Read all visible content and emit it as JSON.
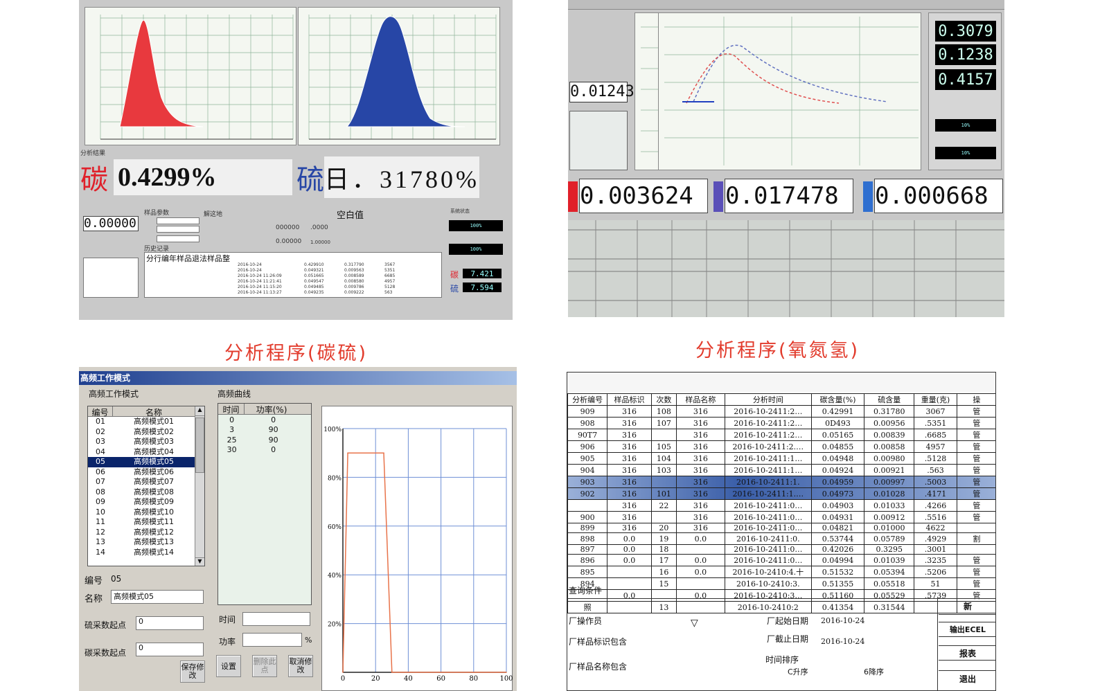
{
  "q1": {
    "title_fragment": "分析程序 碳硫",
    "result_label": "分析结果",
    "carbon_label": "碳",
    "carbon_value": "0.4299%",
    "sulfur_label": "硫",
    "sulfur_value": "日．31780%",
    "lcd_main": "0.00000",
    "sample_params_label": "样品参数",
    "solution_label": "解这地",
    "blank_label": "空白值",
    "system_status_label": "系统状态",
    "history_label": "历史记录",
    "history_header": "分行编年样品退法样品整",
    "sulfur_lcd": "7.594",
    "carbon_lcd": "7.421",
    "status_lcd1": "100%",
    "status_lcd2": "100%",
    "legend_c": "碳",
    "legend_s": "硫",
    "mid_values": [
      "000000",
      ".0000",
      "0.00000",
      "1.00000"
    ],
    "history_rows": [
      [
        "2016-10-24",
        "0.429910",
        "0.317790",
        "3567"
      ],
      [
        "2016-10-24",
        "0.049321",
        "0.009563",
        "5351"
      ],
      [
        "2016-10-24 11:26:09",
        "0.051665",
        "0.008589",
        "6685"
      ],
      [
        "2016-10-24 11:21:41",
        "0.049547",
        "0.008580",
        "4957"
      ],
      [
        "2016-10-24 11:15:20",
        "0.049485",
        "0.009786",
        "5128"
      ],
      [
        "2016-10-24 11:13:27",
        "0.049235",
        "0.009222",
        "563"
      ]
    ]
  },
  "q2": {
    "lcd_left": "0.01243",
    "right_lcds": [
      "0.3079",
      "0.1238",
      "0.4157"
    ],
    "right_small": [
      "10%",
      "10%"
    ],
    "bottom_lcds": [
      "0.003624",
      "0.017478",
      "0.000668"
    ],
    "bottom_colors": [
      "#e0202a",
      "#5a4fb8",
      "#2f6fd0"
    ]
  },
  "captions": {
    "left": "分析程序(碳硫)",
    "right": "分析程序(氧氮氢)"
  },
  "q3": {
    "window_title": "高频工作模式",
    "group_left": "高频工作模式",
    "group_curve": "高频曲线",
    "col_no": "编号",
    "col_name": "名称",
    "modes": [
      {
        "no": "01",
        "name": "高频模式01"
      },
      {
        "no": "02",
        "name": "高频模式02"
      },
      {
        "no": "03",
        "name": "高频模式03"
      },
      {
        "no": "04",
        "name": "高频模式04"
      },
      {
        "no": "05",
        "name": "高频模式05"
      },
      {
        "no": "06",
        "name": "高频模式06"
      },
      {
        "no": "07",
        "name": "高频模式07"
      },
      {
        "no": "08",
        "name": "高频模式08"
      },
      {
        "no": "09",
        "name": "高频模式09"
      },
      {
        "no": "10",
        "name": "高频模式10"
      },
      {
        "no": "11",
        "name": "高频模式11"
      },
      {
        "no": "12",
        "name": "高频模式12"
      },
      {
        "no": "13",
        "name": "高频模式13"
      },
      {
        "no": "14",
        "name": "高频模式14"
      }
    ],
    "selected_index": 4,
    "col_time": "时间",
    "col_power": "功率(%)",
    "curve_rows": [
      {
        "time": "0",
        "power": "0"
      },
      {
        "time": "3",
        "power": "90"
      },
      {
        "time": "25",
        "power": "90"
      },
      {
        "time": "30",
        "power": "0"
      }
    ],
    "no_label": "编号",
    "no_value": "05",
    "name_label": "名称",
    "name_value": "高频模式05",
    "s_start_label": "硫采数起点",
    "s_start_value": "0",
    "c_start_label": "碳采数起点",
    "c_start_value": "0",
    "save_btn": "保存修改",
    "time_label": "时间",
    "power_label": "功率",
    "percent": "%",
    "set_btn": "设置",
    "delete_btn": "删除此点",
    "cancel_btn": "取消修改",
    "y_ticks": [
      "100%",
      "80%",
      "60%",
      "40%",
      "20%"
    ],
    "x_ticks": [
      "0",
      "20",
      "40",
      "60",
      "80",
      "100"
    ]
  },
  "chart_data": {
    "type": "line",
    "x": [
      0,
      3,
      25,
      30,
      100
    ],
    "series": [
      {
        "values": [
          0,
          90,
          90,
          0,
          0
        ]
      }
    ],
    "xlim": [
      0,
      100
    ],
    "ylim": [
      0,
      100
    ],
    "grid": true
  },
  "q4": {
    "headers": [
      "分析编号",
      "样品标识",
      "次数",
      "样品名称",
      "分析时间",
      "碳含量(%)",
      "硫含量",
      "重量(克)",
      "操"
    ],
    "rows": [
      [
        "909",
        "316",
        "108",
        "316",
        "2016-10-2411:2…",
        "0.42991",
        "0.31780",
        "3067",
        "管"
      ],
      [
        "908",
        "316",
        "107",
        "316",
        "2016-10-2411:2…",
        "0D493",
        "0.00956",
        ".5351",
        "管"
      ],
      [
        "90T7",
        "316",
        "",
        "316",
        "2016-10-2411:2…",
        "0.05165",
        "0.00839",
        ".6685",
        "管"
      ],
      [
        "906",
        "316",
        "105",
        "316",
        "2016-10-2411:2.…",
        "0.04855",
        "0.00858",
        "4957",
        "管"
      ],
      [
        "905",
        "316",
        "104",
        "316",
        "2016-10-2411:1…",
        "0.04948",
        "0.00980",
        ".5128",
        "管"
      ],
      [
        "904",
        "316",
        "103",
        "316",
        "2016-10-2411:1…",
        "0.04924",
        "0.00921",
        ".563",
        "管"
      ],
      [
        "903",
        "316",
        "",
        "316",
        "2016-10-2411:1.",
        "0.04959",
        "0.00997",
        ".5003",
        "管"
      ],
      [
        "902",
        "316",
        "101",
        "316",
        "2016-10-2411:1.…",
        "0.04973",
        "0.01028",
        ".4171",
        "管"
      ],
      [
        "",
        "316",
        "22",
        "316",
        "2016-10-2411:0…",
        "0.04903",
        "0.01033",
        ".4266",
        "管"
      ],
      [
        "900",
        "316",
        "",
        "316",
        "2016-10-2411:0…",
        "0.04931",
        "0.00912",
        ".5516",
        "管"
      ],
      [
        "899",
        "316",
        "20",
        "316",
        "2016-10-2411:0…",
        "0.04821",
        "0.01000",
        "4622",
        ""
      ],
      [
        "898",
        "0.0",
        "19",
        "0.0",
        "2016-10-2411:0.",
        "0.53744",
        "0.05789",
        ".4929",
        "割"
      ],
      [
        "897",
        "0.0",
        "18",
        "",
        "2016-10-2411:0…",
        "0.42026",
        "0.3295",
        ".3001",
        ""
      ],
      [
        "896",
        "0.0",
        "17",
        "0.0",
        "2016-10-2411:0…",
        "0.04994",
        "0.01039",
        ".3235",
        "管"
      ],
      [
        "895",
        "",
        "16",
        "0.0",
        "2016-10-2410:4.十",
        "0.51532",
        "0.05394",
        ".5206",
        "管"
      ],
      [
        "894",
        "",
        "15",
        "",
        "2016-10-2410:3.",
        "0.51355",
        "0.05518",
        "51",
        "管"
      ],
      [
        "",
        "0.0",
        "",
        "0.0",
        "2016-10-2410:3…",
        "0.51160",
        "0.05529",
        ".5739",
        "管"
      ],
      [
        "照",
        "",
        "13",
        "",
        "2016-10-2410:2",
        "0.41354",
        "0.31544",
        "",
        ""
      ]
    ],
    "query_label": "查询条件",
    "operator_label": "厂操作员",
    "sample_id_label": "厂样品标识包含",
    "sample_name_label": "厂样品名称包含",
    "start_date_label": "厂起始日期",
    "start_date_value": "2016-10-24",
    "end_date_label": "厂截止日期",
    "end_date_value": "2016-10-24",
    "sort_label": "时间排序",
    "asc_label": "C升序",
    "desc_label": "6降序",
    "btn_new": "新",
    "btn_excel": "输出ECEL",
    "btn_report": "报表",
    "btn_exit": "退出"
  }
}
